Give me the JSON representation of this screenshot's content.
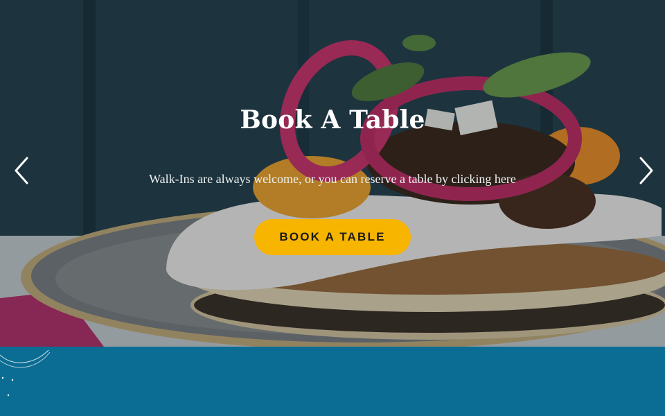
{
  "hero": {
    "title": "Book A Table",
    "subtitle": "Walk-Ins are always welcome, or you can reserve a table by clicking here",
    "cta_label": "BOOK A TABLE"
  },
  "carousel": {
    "prev_icon": "chevron-left-icon",
    "next_icon": "chevron-right-icon"
  },
  "colors": {
    "accent": "#f7b500",
    "band": "#0b6d93",
    "text": "#ffffff"
  }
}
